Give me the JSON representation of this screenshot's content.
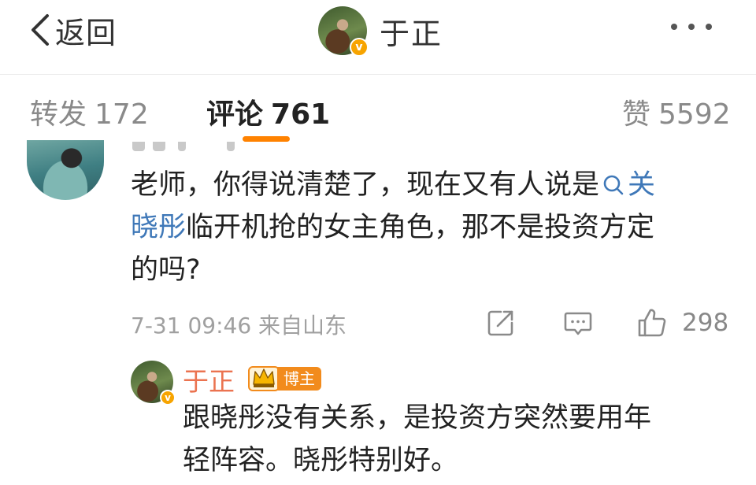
{
  "nav": {
    "back_label": "返回",
    "title": "于正",
    "verified_mark": "v"
  },
  "tabs": {
    "forward": {
      "label": "转发",
      "count": "172"
    },
    "comments": {
      "label": "评论",
      "count": "761"
    },
    "likes": {
      "label": "赞",
      "count": "5592"
    },
    "active": "comments",
    "accent_color": "#ff8200"
  },
  "comment": {
    "text_line1_a": "老师，你得说清楚了，现在又有人说是",
    "topic_part1": "关",
    "topic_part2": "晓彤",
    "text_line2_b": "临开机抢的女主角色，那不是投资方定",
    "text_line3": "的吗?",
    "meta": "7-31 09:46 来自山东",
    "like_count": "298",
    "topic_color": "#3f78b8"
  },
  "reply": {
    "author": "于正",
    "author_color": "#eb7350",
    "badge": "博主",
    "verified_mark": "v",
    "text_line1": "跟晓彤没有关系，是投资方突然要用年",
    "text_line2": "轻阵容。晓彤特别好。"
  },
  "icons": {
    "back": "chevron-left-icon",
    "more": "more-dots-icon",
    "topic": "search-icon",
    "share": "share-icon",
    "reply": "comment-icon",
    "like": "thumbs-up-icon",
    "crown": "crown-icon"
  }
}
